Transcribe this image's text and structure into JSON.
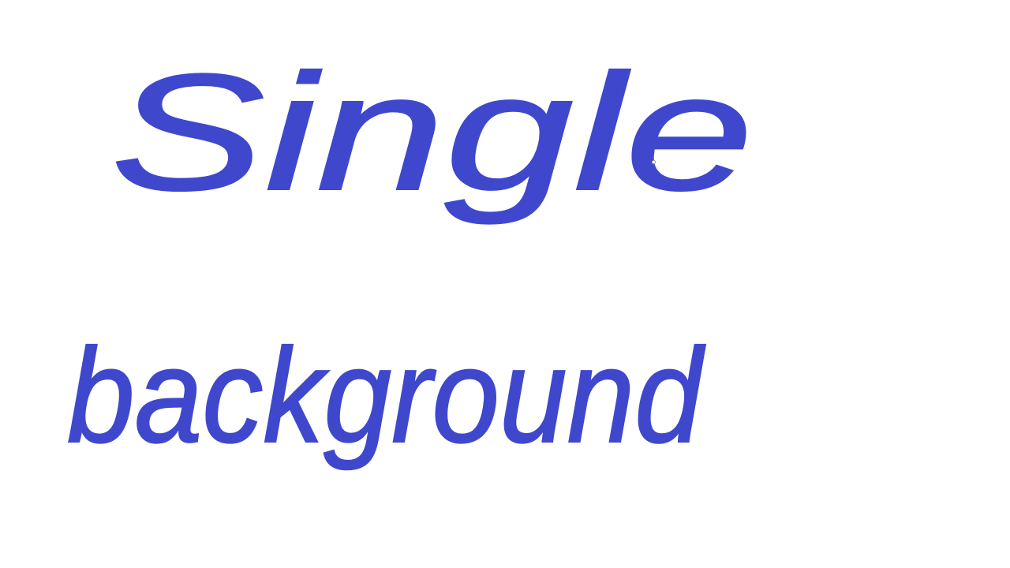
{
  "canvas": {
    "background": "#ffffff",
    "ink_color": "#3f48cc",
    "handwritten_text": "Single background"
  },
  "cursor": {
    "icon": "eraser-circle-cursor"
  }
}
